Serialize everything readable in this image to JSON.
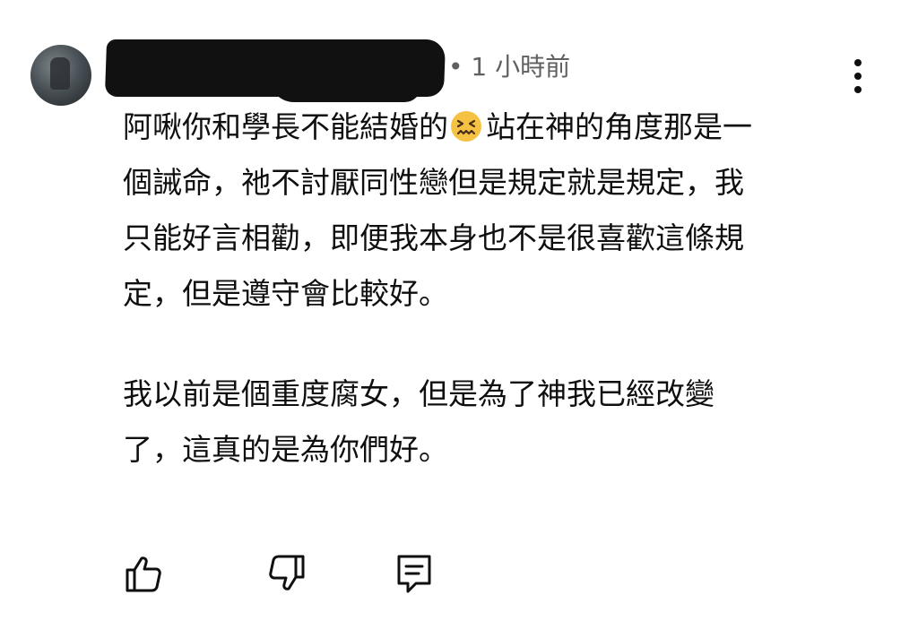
{
  "comment": {
    "timestamp": "• 1 小時前",
    "paragraph1": {
      "line1_before_emoji": "阿啾你和學長不能結婚的",
      "emoji": "confounded-face-emoji",
      "line1_after_emoji": "站在神的角度那是一",
      "line2": "個誡命，祂不討厭同性戀但是規定就是規定，我",
      "line3": "只能好言相勸，即便我本身也不是很喜歡這條規",
      "line4": "定，但是遵守會比較好。"
    },
    "paragraph2": {
      "line1": "我以前是個重度腐女，但是為了神我已經改變",
      "line2": "了，這真的是為你們好。"
    }
  },
  "actions": {
    "like_icon": "thumbs-up-icon",
    "dislike_icon": "thumbs-down-icon",
    "reply_icon": "reply-comment-icon"
  },
  "menu": {
    "icon": "more-vertical-icon"
  },
  "colors": {
    "text": "#0f0f0f",
    "secondary_text": "#606060",
    "emoji_face": "#f6c244"
  }
}
